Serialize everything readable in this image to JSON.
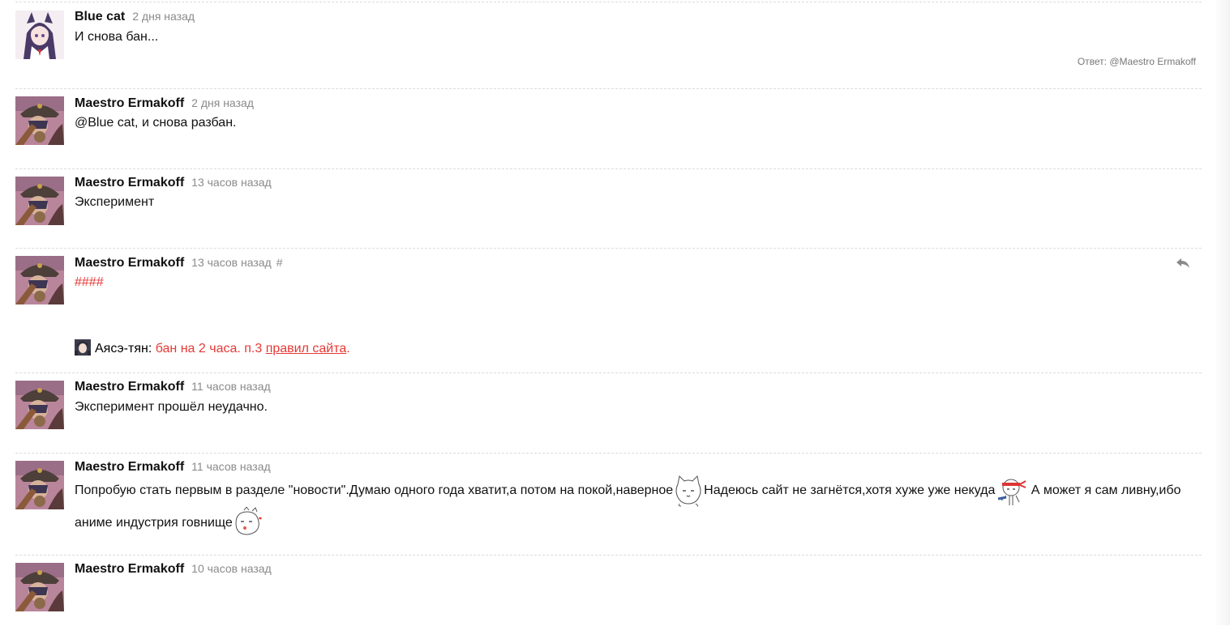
{
  "comments": [
    {
      "author": "Blue cat",
      "time": "2 дня назад",
      "text": "И снова бан...",
      "reply_to": "Ответ: @Maestro Ermakoff"
    },
    {
      "author": "Maestro Ermakoff",
      "time": "2 дня назад",
      "text": "@Blue cat, и снова разбан."
    },
    {
      "author": "Maestro Ermakoff",
      "time": "13 часов назад",
      "text": "Эксперимент"
    },
    {
      "author": "Maestro Ermakoff",
      "time": "13 часов назад",
      "hash": "#",
      "text": "####",
      "moderation": {
        "moderator": "Аясэ-тян:",
        "reason": "бан на 2 часа. п.3",
        "link": "правил сайта",
        "end": "."
      }
    },
    {
      "author": "Maestro Ermakoff",
      "time": "11 часов назад",
      "text": "Эксперимент прошёл неудачно."
    },
    {
      "author": "Maestro Ermakoff",
      "time": "11 часов назад",
      "text_parts": [
        "Попробую стать первым в разделе \"новости\".Думаю одного года хватит,а потом на покой,наверное",
        "Надеюсь сайт не загнётся,хотя хуже уже некуда",
        " А может я сам ливну,ибо",
        "аниме индустрия говнище"
      ]
    },
    {
      "author": "Maestro Ermakoff",
      "time": "10 часов назад",
      "text": ""
    }
  ],
  "colors": {
    "accent_red": "#e53935",
    "time_gray": "#8a8a8a",
    "divider": "#dcdcdc"
  },
  "icons": [
    "reply-icon",
    "cat-smiley-icon",
    "ninja-smiley-icon",
    "kiss-smiley-icon"
  ]
}
